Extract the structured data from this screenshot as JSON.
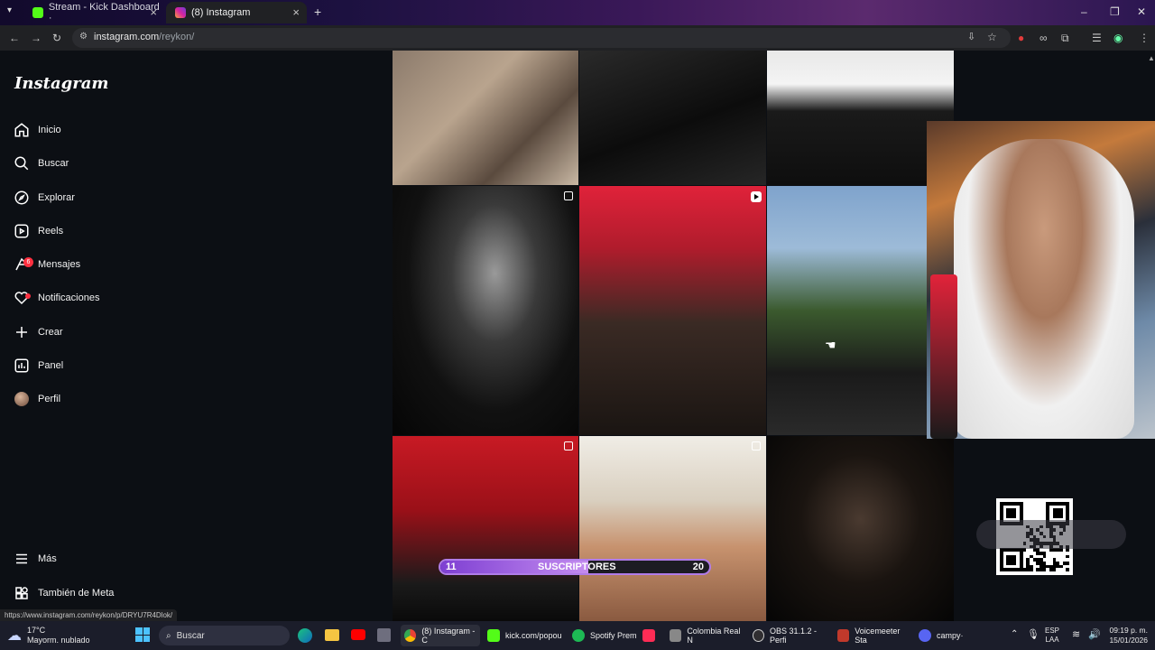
{
  "browser": {
    "tabs": [
      {
        "title": "Stream - Kick Dashboard ·",
        "active": false
      },
      {
        "title": "(8) Instagram",
        "active": true
      }
    ],
    "new_tab": "+",
    "url_host": "instagram.com",
    "url_path": "/reykon/",
    "status_url": "https://www.instagram.com/reykon/p/DRYU7R4Dlok/"
  },
  "sidebar": {
    "logo": "Instagram",
    "items": [
      {
        "label": "Inicio",
        "icon": "home-icon"
      },
      {
        "label": "Buscar",
        "icon": "search-icon"
      },
      {
        "label": "Explorar",
        "icon": "compass-icon"
      },
      {
        "label": "Reels",
        "icon": "reels-icon"
      },
      {
        "label": "Mensajes",
        "icon": "messenger-icon",
        "badge": "6"
      },
      {
        "label": "Notificaciones",
        "icon": "heart-icon"
      },
      {
        "label": "Crear",
        "icon": "plus-icon"
      },
      {
        "label": "Panel",
        "icon": "dashboard-icon"
      },
      {
        "label": "Perfil",
        "icon": "avatar-icon"
      }
    ],
    "more": "Más",
    "meta": "También de Meta"
  },
  "overlay": {
    "subs_label": "SUSCRIPTORES",
    "subs_current": "11",
    "subs_goal": "20",
    "subs_progress": 0.55
  },
  "taskbar": {
    "weather_temp": "17°C",
    "weather_desc": "Mayorm. nublado",
    "search": "Buscar",
    "apps": [
      {
        "label": "(8) Instagram - C",
        "color": "#4285f4"
      },
      {
        "label": "kick.com/popou",
        "color": "#53fc18"
      },
      {
        "label": "Spotify Prem",
        "color": "#1db954"
      },
      {
        "label": "",
        "color": "#fe2c55"
      },
      {
        "label": "Colombia Real N",
        "color": "#888888"
      },
      {
        "label": "OBS 31.1.2 - Perfi",
        "color": "#302e31"
      },
      {
        "label": "Voicemeeter Sta",
        "color": "#c0392b"
      },
      {
        "label": "campy·",
        "color": "#5865f2"
      }
    ],
    "lang_top": "ESP",
    "lang_bottom": "LAA",
    "time": "09:19 p. m.",
    "date": "15/01/2026"
  }
}
